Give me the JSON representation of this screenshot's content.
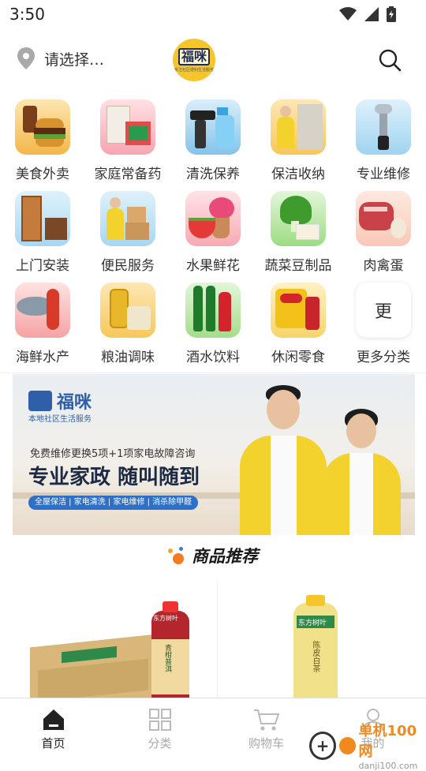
{
  "status_bar": {
    "time": "3:50",
    "icons": [
      "wifi-icon",
      "signal-icon",
      "battery-icon"
    ]
  },
  "header": {
    "location_text": "请选择…",
    "logo_text": "福咪",
    "logo_subtext": "专注社区便利生活服务",
    "search_icon": "search-icon"
  },
  "categories": [
    {
      "label": "美食外卖",
      "icon": "food-icon"
    },
    {
      "label": "家庭常备药",
      "icon": "medicine-icon"
    },
    {
      "label": "清洗保养",
      "icon": "cleaning-icon"
    },
    {
      "label": "保洁收纳",
      "icon": "housekeeping-icon"
    },
    {
      "label": "专业维修",
      "icon": "repair-icon"
    },
    {
      "label": "上门安装",
      "icon": "installation-icon"
    },
    {
      "label": "便民服务",
      "icon": "convenience-icon"
    },
    {
      "label": "水果鲜花",
      "icon": "fruit-flower-icon"
    },
    {
      "label": "蔬菜豆制品",
      "icon": "vegetable-icon"
    },
    {
      "label": "肉禽蛋",
      "icon": "meat-egg-icon"
    },
    {
      "label": "海鲜水产",
      "icon": "seafood-icon"
    },
    {
      "label": "粮油调味",
      "icon": "grain-oil-icon"
    },
    {
      "label": "酒水饮料",
      "icon": "drinks-icon"
    },
    {
      "label": "休闲零食",
      "icon": "snacks-icon"
    },
    {
      "label": "更多分类",
      "icon": "more-icon",
      "box_text": "更"
    }
  ],
  "banner": {
    "brand": "福咪",
    "brand_sub": "本地社区生活服务",
    "line1": "免费维修更换5项+1项家电故障咨询",
    "line2": "专业家政 随叫随到",
    "tags": "全屋保洁 | 家电清洗 | 家电维修 | 消杀除甲醛"
  },
  "section": {
    "title": "商品推荐"
  },
  "products": [
    {
      "brand": "东方树叶",
      "name": "青柑普洱"
    },
    {
      "brand": "东方树叶",
      "name": "陈皮白茶"
    }
  ],
  "tabbar": {
    "tabs": [
      {
        "label": "首页",
        "icon": "home-icon",
        "active": true
      },
      {
        "label": "分类",
        "icon": "category-grid-icon",
        "active": false
      },
      {
        "label": "购物车",
        "icon": "cart-icon",
        "active": false
      },
      {
        "label": "我的",
        "icon": "user-icon",
        "active": false
      }
    ]
  },
  "watermark": {
    "main": "单机100网",
    "url": "danji100.com"
  },
  "colors": {
    "logo_yellow": "#f6c52b",
    "brand_blue": "#2e5fa8",
    "watermark_orange": "#f08a1e"
  }
}
